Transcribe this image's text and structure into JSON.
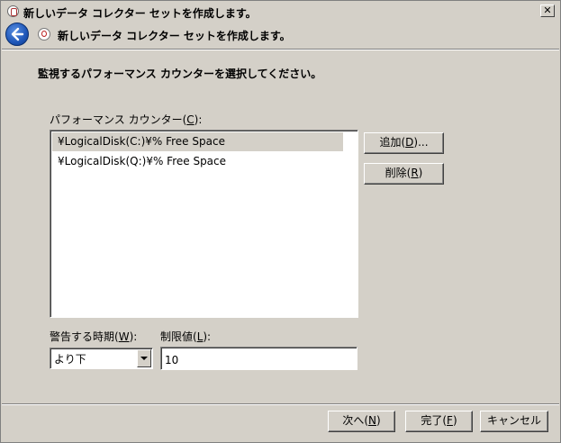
{
  "window": {
    "title": "新しいデータ コレクター セットを作成します。",
    "close_glyph": "✕"
  },
  "header": {
    "title": "新しいデータ コレクター セットを作成します。"
  },
  "main": {
    "instruction": "監視するパフォーマンス カウンターを選択してください。",
    "counters_label": "パフォーマンス カウンター(",
    "counters_label_key": "C",
    "counters_label_end": "):",
    "counters": [
      "¥LogicalDisk(C:)¥% Free Space",
      "¥LogicalDisk(Q:)¥% Free Space"
    ],
    "selected_index": 0,
    "add_button": {
      "text": "追加(",
      "key": "D",
      "end": ")..."
    },
    "remove_button": {
      "text": "削除(",
      "key": "R",
      "end": ")"
    },
    "alert_when_label": {
      "text": "警告する時期(",
      "key": "W",
      "end": "):"
    },
    "alert_when_value": "より下",
    "limit_label": {
      "text": "制限値(",
      "key": "L",
      "end": "):"
    },
    "limit_value": "10"
  },
  "footer": {
    "next_button": {
      "text": "次へ(",
      "key": "N",
      "end": ")"
    },
    "finish_button": {
      "text": "完了(",
      "key": "F",
      "end": ")"
    },
    "cancel_button": "キャンセル"
  },
  "colors": {
    "face": "#d4d0c8",
    "back_button": "#1e56b8"
  }
}
